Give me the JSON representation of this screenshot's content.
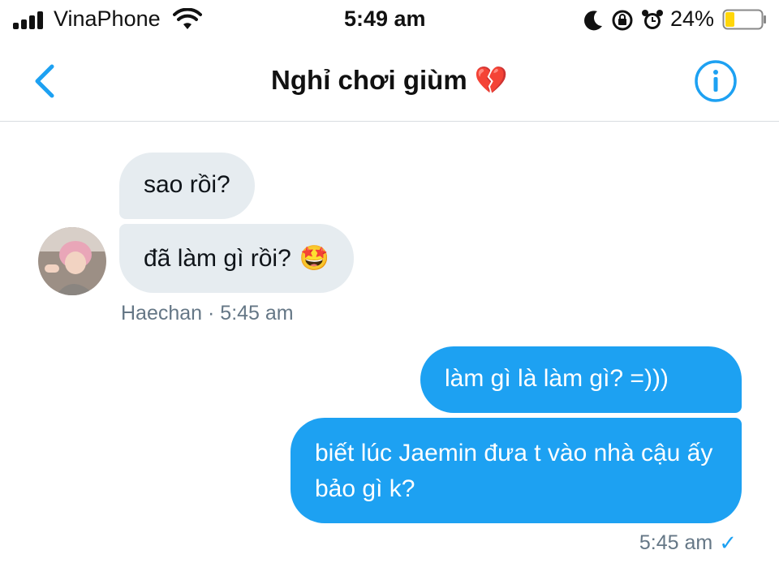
{
  "status_bar": {
    "carrier": "VinaPhone",
    "time": "5:49 am",
    "battery": "24%",
    "icons": [
      "signal-icon",
      "wifi-icon",
      "moon-icon",
      "orientation-lock-icon",
      "alarm-icon",
      "battery-icon"
    ]
  },
  "header": {
    "title": "Nghỉ chơi giùm 💔",
    "back_icon": "chevron-left-icon",
    "info_icon": "info-icon"
  },
  "messages": [
    {
      "sender": "Haechan",
      "direction": "incoming",
      "text": "sao rồi?"
    },
    {
      "sender": "Haechan",
      "direction": "incoming",
      "text": "đã làm gì rồi?",
      "emoji": "🤩"
    },
    {
      "direction": "outgoing",
      "text": "làm gì là làm gì? =)))"
    },
    {
      "direction": "outgoing",
      "text": "biết lúc Jaemin đưa t vào nhà cậu ấy bảo gì k?"
    }
  ],
  "meta": {
    "incoming": "Haechan · 5:45 am",
    "outgoing": "5:45 am",
    "read_mark": "✓"
  },
  "colors": {
    "accent": "#1da1f2",
    "incoming_bubble": "#e6ecf0",
    "meta_text": "#657786"
  }
}
